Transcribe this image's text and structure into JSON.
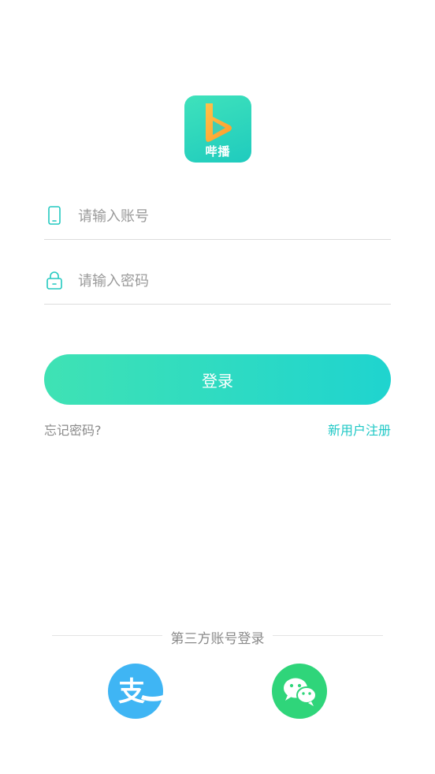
{
  "app": {
    "logo_text": "哔播"
  },
  "form": {
    "account_placeholder": "请输入账号",
    "password_placeholder": "请输入密码",
    "login_label": "登录",
    "forgot_label": "忘记密码?",
    "register_label": "新用户注册"
  },
  "third_party": {
    "title": "第三方账号登录",
    "providers": [
      {
        "name": "alipay",
        "icon": "alipay-icon",
        "color": "#3fb5f4",
        "glyph": "支"
      },
      {
        "name": "wechat",
        "icon": "wechat-icon",
        "color": "#2fd57a"
      }
    ]
  },
  "colors": {
    "accent": "#1fc8c6",
    "button_start": "#3fe2b4",
    "button_end": "#1fd4cf"
  }
}
